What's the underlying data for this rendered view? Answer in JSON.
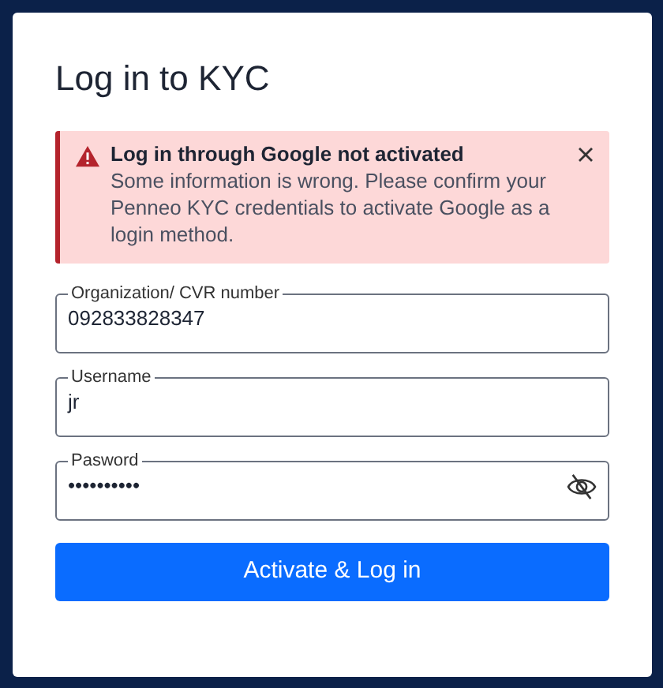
{
  "title": "Log in to KYC",
  "alert": {
    "title": "Log in through Google not activated",
    "message": "Some information is wrong. Please confirm your Penneo KYC credentials to activate Google as a login method."
  },
  "fields": [
    {
      "label": "Organization/ CVR number",
      "value": "092833828347",
      "kind": "text"
    },
    {
      "label": "Username",
      "value": "jr",
      "kind": "text"
    },
    {
      "label": "Pasword",
      "value": "••••••••••",
      "kind": "password"
    }
  ],
  "button": "Activate & Log in"
}
